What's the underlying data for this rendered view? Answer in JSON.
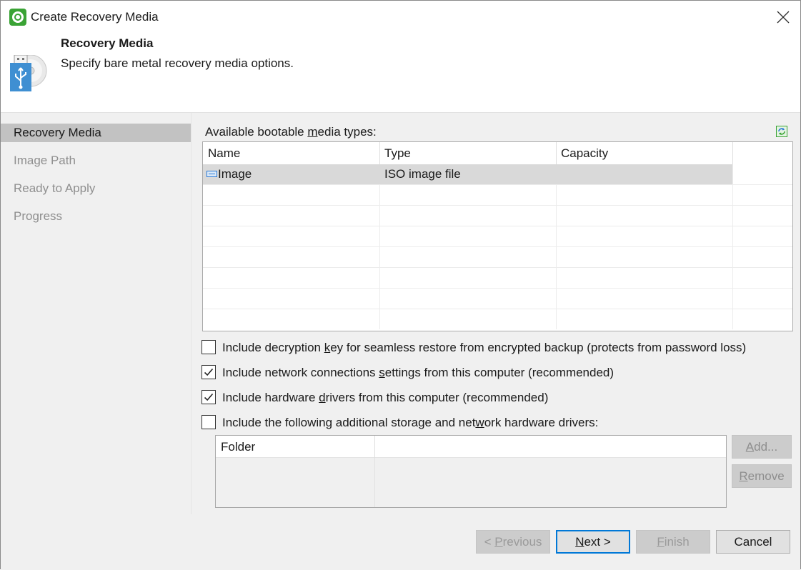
{
  "window": {
    "title": "Create Recovery Media"
  },
  "header": {
    "title": "Recovery Media",
    "subtitle": "Specify bare metal recovery media options."
  },
  "steps": [
    {
      "label": "Recovery Media",
      "active": true
    },
    {
      "label": "Image Path",
      "active": false
    },
    {
      "label": "Ready to Apply",
      "active": false
    },
    {
      "label": "Progress",
      "active": false
    }
  ],
  "media": {
    "label_before": "Available bootable ",
    "label_mnemonic": "m",
    "label_after": "edia types:",
    "columns": [
      "Name",
      "Type",
      "Capacity"
    ],
    "rows": [
      {
        "name": "Image",
        "type": "ISO image file",
        "capacity": "",
        "icon": "media-icon",
        "selected": true
      }
    ]
  },
  "options": [
    {
      "before": "Include decryption ",
      "mnemonic": "k",
      "after": "ey for seamless restore from encrypted backup (protects from password loss)",
      "checked": false
    },
    {
      "before": "Include network connections ",
      "mnemonic": "s",
      "after": "ettings from this computer (recommended)",
      "checked": true
    },
    {
      "before": "Include hardware ",
      "mnemonic": "d",
      "after": "rivers from this computer (recommended)",
      "checked": true
    },
    {
      "before": "Include the following additional storage and net",
      "mnemonic": "w",
      "after": "ork hardware drivers:",
      "checked": false
    }
  ],
  "drivers": {
    "column": "Folder",
    "add": {
      "mnemonic": "A",
      "rest": "dd..."
    },
    "remove": {
      "mnemonic": "R",
      "rest": "emove"
    }
  },
  "footer": {
    "previous": {
      "before": "< ",
      "mnemonic": "P",
      "after": "revious"
    },
    "next": {
      "mnemonic": "N",
      "after": "ext >"
    },
    "finish": {
      "mnemonic": "F",
      "after": "inish"
    },
    "cancel": "Cancel"
  },
  "colors": {
    "accent": "#0078d7",
    "brand": "#3aa335",
    "selection": "#c2c2c2"
  }
}
